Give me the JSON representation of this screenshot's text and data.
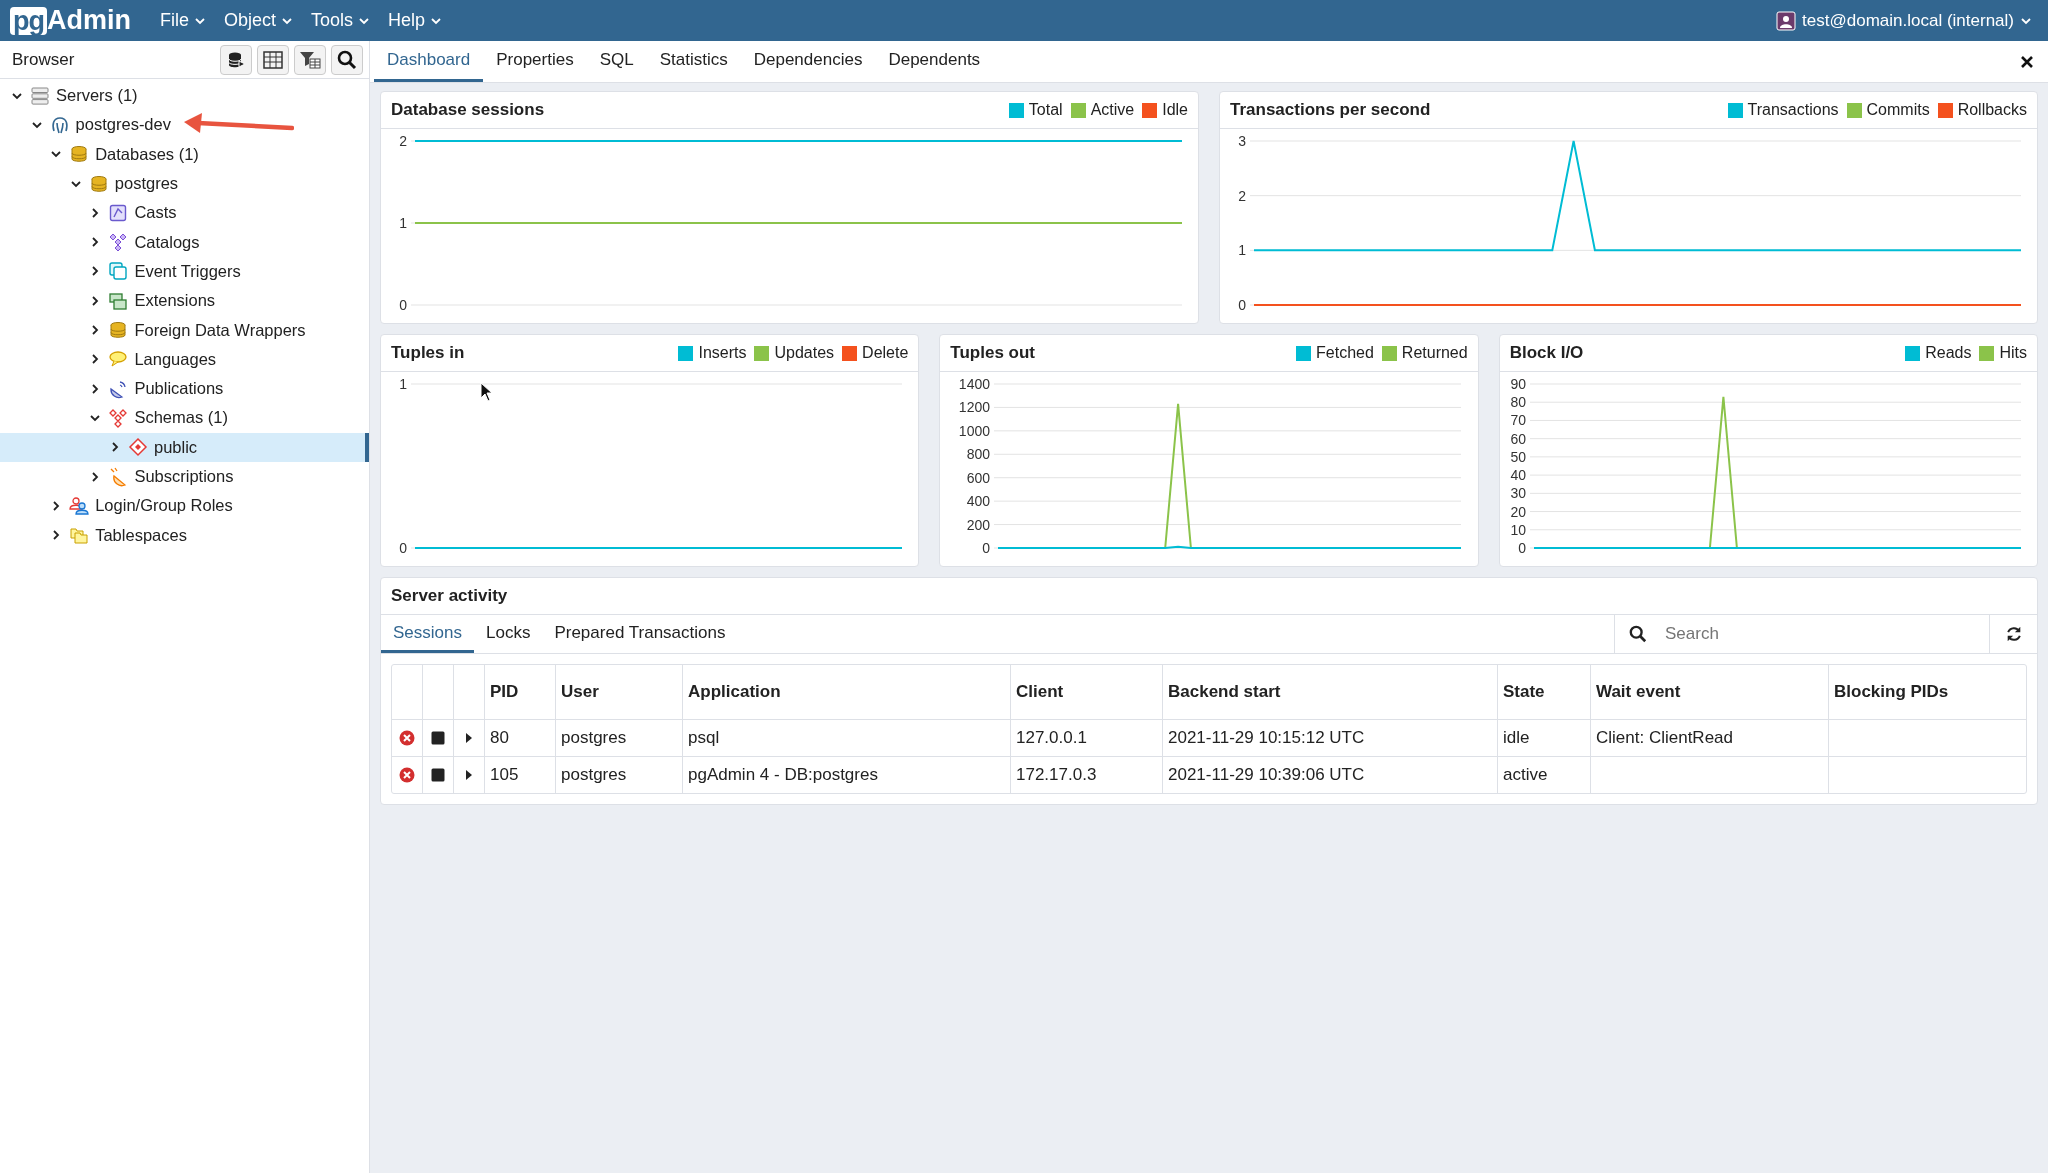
{
  "top_bar": {
    "logo": {
      "prefix": "pg",
      "name": "Admin"
    },
    "menus": [
      "File",
      "Object",
      "Tools",
      "Help"
    ],
    "user": "test@domain.local (internal)"
  },
  "browser": {
    "title": "Browser",
    "tree": [
      {
        "label": "Servers (1)",
        "kind": "server-group",
        "expanded": true,
        "selected": false,
        "children": [
          {
            "label": "postgres-dev",
            "kind": "server",
            "expanded": true,
            "selected": false,
            "children": [
              {
                "label": "Databases (1)",
                "kind": "database-group",
                "expanded": true,
                "selected": false,
                "children": [
                  {
                    "label": "postgres",
                    "kind": "database",
                    "expanded": true,
                    "selected": false,
                    "children": [
                      {
                        "label": "Casts",
                        "kind": "casts",
                        "expanded": false,
                        "selected": false
                      },
                      {
                        "label": "Catalogs",
                        "kind": "catalogs",
                        "expanded": false,
                        "selected": false
                      },
                      {
                        "label": "Event Triggers",
                        "kind": "event-triggers",
                        "expanded": false,
                        "selected": false
                      },
                      {
                        "label": "Extensions",
                        "kind": "extensions",
                        "expanded": false,
                        "selected": false
                      },
                      {
                        "label": "Foreign Data Wrappers",
                        "kind": "fdw",
                        "expanded": false,
                        "selected": false
                      },
                      {
                        "label": "Languages",
                        "kind": "languages",
                        "expanded": false,
                        "selected": false
                      },
                      {
                        "label": "Publications",
                        "kind": "publications",
                        "expanded": false,
                        "selected": false
                      },
                      {
                        "label": "Schemas (1)",
                        "kind": "schemas",
                        "expanded": true,
                        "selected": false,
                        "children": [
                          {
                            "label": "public",
                            "kind": "schema",
                            "expanded": false,
                            "selected": true
                          }
                        ]
                      },
                      {
                        "label": "Subscriptions",
                        "kind": "subscriptions",
                        "expanded": false,
                        "selected": false
                      }
                    ]
                  }
                ]
              },
              {
                "label": "Login/Group Roles",
                "kind": "roles",
                "expanded": false,
                "selected": false
              },
              {
                "label": "Tablespaces",
                "kind": "tablespaces",
                "expanded": false,
                "selected": false
              }
            ]
          }
        ]
      }
    ]
  },
  "tabs": [
    {
      "label": "Dashboard",
      "selected": true
    },
    {
      "label": "Properties",
      "selected": false
    },
    {
      "label": "SQL",
      "selected": false
    },
    {
      "label": "Statistics",
      "selected": false
    },
    {
      "label": "Dependencies",
      "selected": false
    },
    {
      "label": "Dependents",
      "selected": false
    }
  ],
  "charts": [
    {
      "chart_data": {
        "type": "line",
        "title": "Database sessions",
        "grid": true,
        "ylim": [
          0,
          2
        ],
        "yticks": [
          0,
          1,
          2
        ],
        "series": [
          {
            "name": "Total",
            "color": "#00bcd4",
            "values": [
              2,
              2,
              2,
              2,
              2,
              2,
              2,
              2,
              2,
              2,
              2,
              2,
              2,
              2,
              2,
              2,
              2,
              2,
              2,
              2,
              2,
              2,
              2,
              2,
              2,
              2,
              2,
              2,
              2,
              2,
              2,
              2,
              2,
              2,
              2,
              2,
              2
            ]
          },
          {
            "name": "Active",
            "color": "#8bc34a",
            "values": [
              1,
              1,
              1,
              1,
              1,
              1,
              1,
              1,
              1,
              1,
              1,
              1,
              1,
              1,
              1,
              1,
              1,
              1,
              1,
              1,
              1,
              1,
              1,
              1,
              1,
              1,
              1,
              1,
              1,
              1,
              1,
              1,
              1,
              1,
              1,
              1,
              1
            ]
          },
          {
            "name": "Idle",
            "color": "#f4511e",
            "values": [
              null,
              null,
              null,
              null,
              null,
              null,
              null,
              null,
              null,
              null,
              null,
              null,
              null,
              null,
              null,
              null,
              null,
              null,
              null,
              null,
              null,
              null,
              null,
              null,
              null,
              null,
              null,
              null,
              null,
              null,
              null,
              null,
              null,
              null,
              null,
              null,
              null
            ]
          }
        ]
      }
    },
    {
      "chart_data": {
        "type": "line",
        "title": "Transactions per second",
        "grid": true,
        "ylim": [
          0,
          3
        ],
        "yticks": [
          0,
          1,
          2,
          3
        ],
        "series": [
          {
            "name": "Transactions",
            "color": "#00bcd4",
            "values": [
              1,
              1,
              1,
              1,
              1,
              1,
              1,
              1,
              1,
              1,
              1,
              1,
              1,
              1,
              1,
              3,
              1,
              1,
              1,
              1,
              1,
              1,
              1,
              1,
              1,
              1,
              1,
              1,
              1,
              1,
              1,
              1,
              1,
              1,
              1,
              1,
              1
            ]
          },
          {
            "name": "Commits",
            "color": "#8bc34a",
            "values": [
              null,
              null,
              null,
              null,
              null,
              null,
              null,
              null,
              null,
              null,
              null,
              null,
              null,
              null,
              null,
              null,
              null,
              null,
              null,
              null,
              null,
              null,
              null,
              null,
              null,
              null,
              null,
              null,
              null,
              null,
              null,
              null,
              null,
              null,
              null,
              null,
              null
            ]
          },
          {
            "name": "Rollbacks",
            "color": "#f4511e",
            "values": [
              0,
              0,
              0,
              0,
              0,
              0,
              0,
              0,
              0,
              0,
              0,
              0,
              0,
              0,
              0,
              0,
              0,
              0,
              0,
              0,
              0,
              0,
              0,
              0,
              0,
              0,
              0,
              0,
              0,
              0,
              0,
              0,
              0,
              0,
              0,
              0,
              0
            ]
          }
        ]
      }
    },
    {
      "chart_data": {
        "type": "line",
        "title": "Tuples in",
        "grid": true,
        "ylim": [
          0,
          1
        ],
        "yticks": [
          0,
          1
        ],
        "series": [
          {
            "name": "Inserts",
            "color": "#00bcd4",
            "values": [
              0,
              0,
              0,
              0,
              0,
              0,
              0,
              0,
              0,
              0,
              0,
              0,
              0,
              0,
              0,
              0,
              0,
              0,
              0,
              0,
              0,
              0,
              0,
              0,
              0,
              0,
              0,
              0,
              0,
              0,
              0,
              0,
              0,
              0,
              0,
              0,
              0
            ]
          },
          {
            "name": "Updates",
            "color": "#8bc34a",
            "values": [
              null,
              null,
              null,
              null,
              null,
              null,
              null,
              null,
              null,
              null,
              null,
              null,
              null,
              null,
              null,
              null,
              null,
              null,
              null,
              null,
              null,
              null,
              null,
              null,
              null,
              null,
              null,
              null,
              null,
              null,
              null,
              null,
              null,
              null,
              null,
              null,
              null
            ]
          },
          {
            "name": "Delete",
            "color": "#f4511e",
            "values": [
              null,
              null,
              null,
              null,
              null,
              null,
              null,
              null,
              null,
              null,
              null,
              null,
              null,
              null,
              null,
              null,
              null,
              null,
              null,
              null,
              null,
              null,
              null,
              null,
              null,
              null,
              null,
              null,
              null,
              null,
              null,
              null,
              null,
              null,
              null,
              null,
              null
            ]
          }
        ]
      }
    },
    {
      "chart_data": {
        "type": "line",
        "title": "Tuples out",
        "grid": true,
        "ylim": [
          0,
          1400
        ],
        "yticks": [
          0,
          200,
          400,
          600,
          800,
          1000,
          1200,
          1400
        ],
        "series": [
          {
            "name": "Fetched",
            "color": "#00bcd4",
            "values": [
              0,
              0,
              0,
              0,
              0,
              0,
              0,
              0,
              0,
              0,
              0,
              0,
              0,
              0,
              10,
              0,
              0,
              0,
              0,
              0,
              0,
              0,
              0,
              0,
              0,
              0,
              0,
              0,
              0,
              0,
              0,
              0,
              0,
              0,
              0,
              0,
              0
            ]
          },
          {
            "name": "Returned",
            "color": "#8bc34a",
            "values": [
              null,
              null,
              null,
              null,
              null,
              null,
              null,
              null,
              null,
              null,
              null,
              null,
              null,
              0,
              1230,
              0,
              null,
              null,
              null,
              null,
              null,
              null,
              null,
              null,
              null,
              null,
              null,
              null,
              null,
              null,
              null,
              null,
              null,
              null,
              null,
              null,
              null
            ]
          }
        ]
      }
    },
    {
      "chart_data": {
        "type": "line",
        "title": "Block I/O",
        "grid": true,
        "ylim": [
          0,
          90
        ],
        "yticks": [
          0,
          10,
          20,
          30,
          40,
          50,
          60,
          70,
          80,
          90
        ],
        "series": [
          {
            "name": "Reads",
            "color": "#00bcd4",
            "values": [
              0,
              0,
              0,
              0,
              0,
              0,
              0,
              0,
              0,
              0,
              0,
              0,
              0,
              0,
              0,
              0,
              0,
              0,
              0,
              0,
              0,
              0,
              0,
              0,
              0,
              0,
              0,
              0,
              0,
              0,
              0,
              0,
              0,
              0,
              0,
              0,
              0
            ]
          },
          {
            "name": "Hits",
            "color": "#8bc34a",
            "values": [
              null,
              null,
              null,
              null,
              null,
              null,
              null,
              null,
              null,
              null,
              null,
              null,
              null,
              0,
              83,
              0,
              null,
              null,
              null,
              null,
              null,
              null,
              null,
              null,
              null,
              null,
              null,
              null,
              null,
              null,
              null,
              null,
              null,
              null,
              null,
              null,
              null
            ]
          }
        ]
      }
    }
  ],
  "server_activity": {
    "title": "Server activity",
    "tabs": [
      {
        "label": "Sessions",
        "selected": true
      },
      {
        "label": "Locks",
        "selected": false
      },
      {
        "label": "Prepared Transactions",
        "selected": false
      }
    ],
    "search": {
      "placeholder": "Search"
    },
    "columns": [
      "PID",
      "User",
      "Application",
      "Client",
      "Backend start",
      "State",
      "Wait event",
      "Blocking PIDs"
    ],
    "rows": [
      [
        "80",
        "postgres",
        "psql",
        "127.0.0.1",
        "2021-11-29 10:15:12 UTC",
        "idle",
        "Client: ClientRead",
        ""
      ],
      [
        "105",
        "postgres",
        "pgAdmin 4 - DB:postgres",
        "172.17.0.3",
        "2021-11-29 10:39:06 UTC",
        "active",
        "",
        ""
      ]
    ]
  }
}
